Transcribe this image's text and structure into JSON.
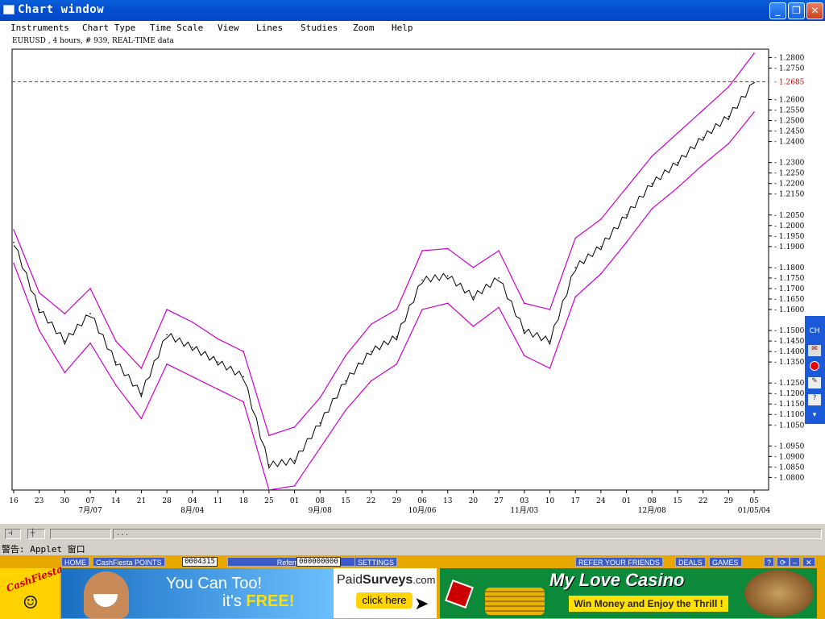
{
  "window": {
    "title": "Chart window",
    "minimize": "_",
    "restore": "❐",
    "close": "✕"
  },
  "menu": [
    "Instruments",
    "Chart Type",
    "Time Scale",
    "View",
    "Lines",
    "Studies",
    "Zoom",
    "Help"
  ],
  "chart": {
    "label": "EURUSD , 4 hours, # 939, REAL-TIME data",
    "current_price": "1.2685",
    "x_day_labels": [
      "16",
      "23",
      "30",
      "07",
      "14",
      "21",
      "28",
      "04",
      "11",
      "18",
      "25",
      "01",
      "08",
      "15",
      "22",
      "29",
      "06",
      "13",
      "20",
      "27",
      "03",
      "10",
      "17",
      "24",
      "01",
      "08",
      "15",
      "22",
      "29",
      "05"
    ],
    "x_month_labels": [
      "7月/07",
      "8月/04",
      "9月/08",
      "10月/06",
      "11月/03",
      "12月/08",
      "01/05/04"
    ],
    "y_labels": [
      "1.2800",
      "1.2750",
      "1.2600",
      "1.2550",
      "1.2500",
      "1.2450",
      "1.2400",
      "1.2300",
      "1.2250",
      "1.2200",
      "1.2150",
      "1.2050",
      "1.2000",
      "1.1950",
      "1.1900",
      "1.1800",
      "1.1750",
      "1.1700",
      "1.1650",
      "1.1600",
      "1.1500",
      "1.1450",
      "1.1400",
      "1.1350",
      "1.1250",
      "1.1200",
      "1.1150",
      "1.1100",
      "1.1050",
      "1.0950",
      "1.0900",
      "1.0850",
      "1.0800"
    ],
    "colors": {
      "price": "#000000",
      "bands": "#cc00cc",
      "current": "#cc0000"
    }
  },
  "chart_data": {
    "type": "line",
    "title": "EURUSD , 4 hours, # 939, REAL-TIME data",
    "xlabel": "",
    "ylabel": "",
    "ylim": [
      1.074,
      1.284
    ],
    "x": [
      "06/16",
      "06/23",
      "06/30",
      "07/07",
      "07/14",
      "07/21",
      "07/28",
      "08/04",
      "08/11",
      "08/18",
      "08/25",
      "09/01",
      "09/08",
      "09/15",
      "09/22",
      "09/29",
      "10/06",
      "10/13",
      "10/20",
      "10/27",
      "11/03",
      "11/10",
      "11/17",
      "11/24",
      "12/01",
      "12/08",
      "12/15",
      "12/22",
      "12/29",
      "01/05"
    ],
    "series": [
      {
        "values": [
          1.192,
          1.16,
          1.145,
          1.158,
          1.135,
          1.12,
          1.148,
          1.142,
          1.135,
          1.128,
          1.086,
          1.088,
          1.106,
          1.126,
          1.14,
          1.147,
          1.174,
          1.176,
          1.166,
          1.175,
          1.15,
          1.145,
          1.18,
          1.19,
          1.205,
          1.22,
          1.23,
          1.242,
          1.252,
          1.268
        ]
      },
      {
        "values": [
          1.198,
          1.168,
          1.158,
          1.17,
          1.145,
          1.132,
          1.16,
          1.154,
          1.146,
          1.14,
          1.1,
          1.104,
          1.118,
          1.138,
          1.153,
          1.16,
          1.188,
          1.189,
          1.18,
          1.188,
          1.163,
          1.16,
          1.194,
          1.203,
          1.218,
          1.233,
          1.244,
          1.255,
          1.266,
          1.282
        ]
      },
      {
        "values": [
          1.182,
          1.15,
          1.13,
          1.144,
          1.124,
          1.108,
          1.134,
          1.128,
          1.122,
          1.116,
          1.074,
          1.076,
          1.094,
          1.112,
          1.126,
          1.134,
          1.16,
          1.163,
          1.152,
          1.161,
          1.138,
          1.132,
          1.166,
          1.177,
          1.192,
          1.208,
          1.218,
          1.229,
          1.239,
          1.254
        ]
      }
    ],
    "hline": 1.2685,
    "grid": false
  },
  "status": {
    "field3": "...",
    "warning": "警告: Applet 窗口"
  },
  "ad": {
    "home": "HOME",
    "points_label": "CashFiesta POINTS",
    "points_value": "0004315",
    "referrals_label": "Referrals",
    "referrals_value": "000000000",
    "settings": "SETTINGS",
    "refer": "REFER YOUR FRIENDS",
    "deals": "DEALS",
    "games": "GAMES",
    "btn_help": "?",
    "btn_refresh": "⟳",
    "btn_min": "–",
    "btn_close": "✕",
    "logo": "CashFiesta",
    "b1_line1": "You Can Too!",
    "b1_line2a": "it's",
    "b1_line2b": "FREE!",
    "b1_brand_a": "Paid",
    "b1_brand_b": "Surveys",
    "b1_brand_c": ".com",
    "b1_click": "click here",
    "b2_title": "My Love Casino",
    "b2_sub": "Win Money and Enjoy the Thrill !"
  }
}
